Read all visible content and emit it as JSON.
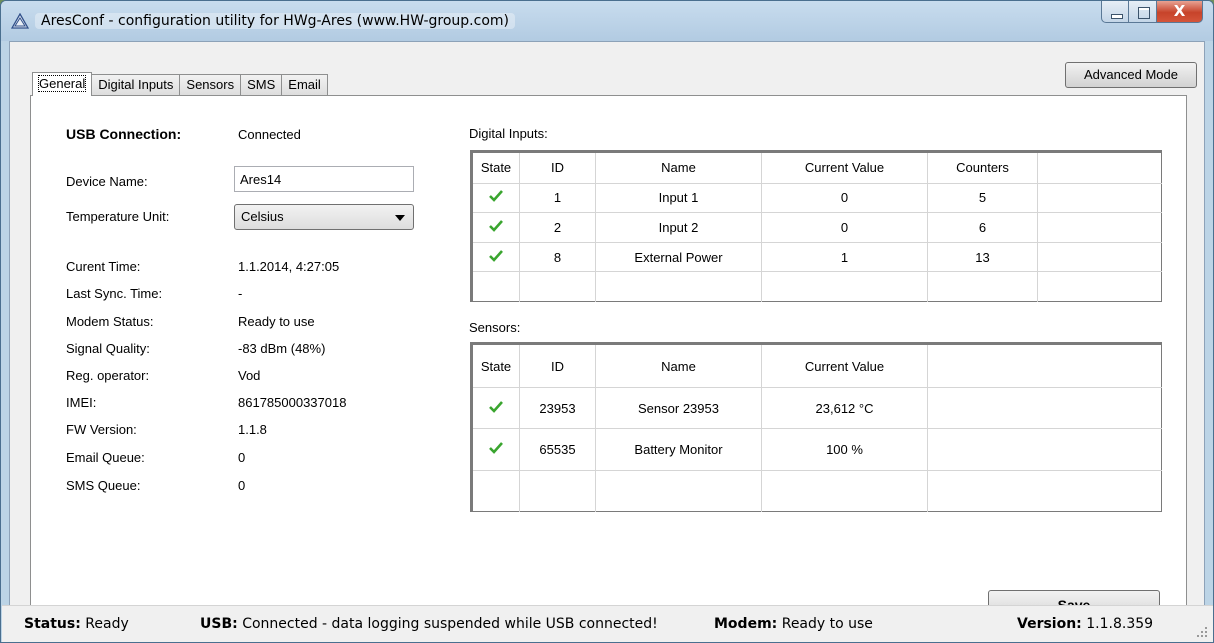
{
  "window": {
    "title": "AresConf - configuration utility for HWg-Ares (www.HW-group.com)",
    "close_glyph": "X"
  },
  "tabs": [
    {
      "label": "General",
      "active": true
    },
    {
      "label": "Digital Inputs",
      "active": false
    },
    {
      "label": "Sensors",
      "active": false
    },
    {
      "label": "SMS",
      "active": false
    },
    {
      "label": "Email",
      "active": false
    }
  ],
  "advanced_mode_label": "Advanced Mode",
  "general": {
    "usb_connection_label": "USB Connection:",
    "usb_connection_value": "Connected",
    "device_name_label": "Device Name:",
    "device_name_value": "Ares14",
    "temperature_unit_label": "Temperature Unit:",
    "temperature_unit_value": "Celsius",
    "fields": [
      {
        "label": "Curent Time:",
        "value": "1.1.2014, 4:27:05"
      },
      {
        "label": "Last Sync. Time:",
        "value": "-"
      },
      {
        "label": "Modem Status:",
        "value": "Ready to use"
      },
      {
        "label": "Signal Quality:",
        "value": "-83 dBm (48%)"
      },
      {
        "label": "Reg. operator:",
        "value": "Vod"
      },
      {
        "label": "IMEI:",
        "value": "861785000337018"
      },
      {
        "label": "FW Version:",
        "value": "1.1.8"
      },
      {
        "label": "Email Queue:",
        "value": "0"
      },
      {
        "label": "SMS Queue:",
        "value": "0"
      }
    ]
  },
  "digital_inputs": {
    "title": "Digital Inputs:",
    "columns": [
      "State",
      "ID",
      "Name",
      "Current Value",
      "Counters"
    ],
    "rows": [
      {
        "state": "ok",
        "id": "1",
        "name": "Input 1",
        "value": "0",
        "counters": "5"
      },
      {
        "state": "ok",
        "id": "2",
        "name": "Input 2",
        "value": "0",
        "counters": "6"
      },
      {
        "state": "ok",
        "id": "8",
        "name": "External Power",
        "value": "1",
        "counters": "13"
      }
    ]
  },
  "sensors": {
    "title": "Sensors:",
    "columns": [
      "State",
      "ID",
      "Name",
      "Current Value"
    ],
    "rows": [
      {
        "state": "ok",
        "id": "23953",
        "name": "Sensor 23953",
        "value": "23,612 °C"
      },
      {
        "state": "ok",
        "id": "65535",
        "name": "Battery Monitor",
        "value": "100 %"
      }
    ]
  },
  "save_label": "Save",
  "save_mnemonic": "S",
  "save_rest": "ave",
  "status_bar": {
    "status_label": "Status:",
    "status_value": "Ready",
    "usb_label": "USB:",
    "usb_value": "Connected - data logging suspended while USB connected!",
    "modem_label": "Modem:",
    "modem_value": "Ready to use",
    "version_label": "Version:",
    "version_value": "1.1.8.359"
  },
  "colors": {
    "check_green": "#3aa52f",
    "title_bar": "#bcd4e6",
    "close_red": "#c7432a"
  }
}
